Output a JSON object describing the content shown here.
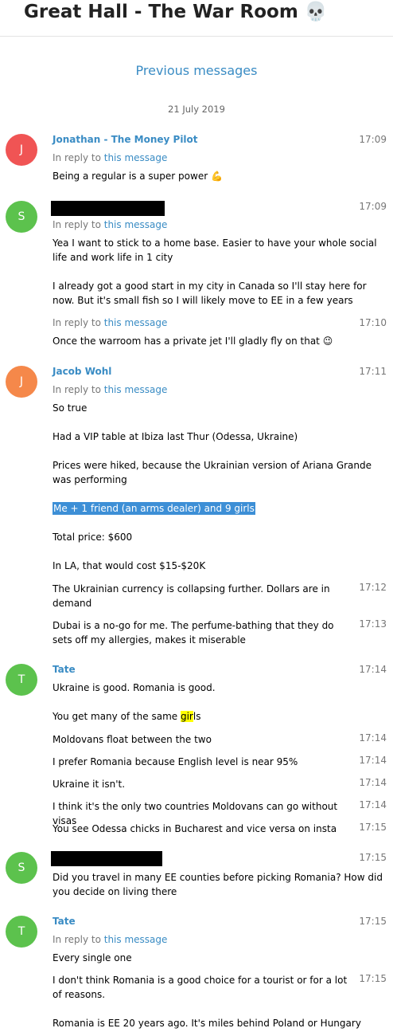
{
  "header": {
    "title": "Great Hall - The War Room",
    "title_icon": "💀"
  },
  "previous_messages": "Previous messages",
  "date_separator": "21 July 2019",
  "reply_prefix": "In reply to ",
  "reply_link": "this message",
  "colors": {
    "accent": "#3a8cc4",
    "avatar_red": "#f05454",
    "avatar_green": "#5cc24d",
    "avatar_orange": "#f5884a"
  },
  "messages": [
    {
      "avatar": "J",
      "sender": "Jonathan - The Money Pilot",
      "time": "17:09",
      "text": "Being a regular is a super power",
      "emoji": "💪"
    },
    {
      "avatar": "S",
      "time": "17:09",
      "text1": "Yea I want to stick to a home base. Easier to have your whole social life and work life in 1 city",
      "text2": "I already got a good start in my city in Canada so I'll stay here for now. But it's small fish so I will likely move to EE in a few years",
      "time2": "17:10",
      "text3": "Once the warroom has a private jet I'll gladly fly on that",
      "emoji3": "😉"
    },
    {
      "avatar": "J",
      "sender": "Jacob Wohl",
      "time": "17:11",
      "lines": [
        "So true",
        "Had a VIP table at Ibiza last Thur (Odessa, Ukraine)",
        "Prices were hiked, because the Ukrainian version of Ariana Grande was performing",
        "Me + 1 friend (an arms dealer) and 9 girls",
        "Total price: $600",
        "In LA, that would cost $15-$20K"
      ],
      "text_b": "The Ukrainian currency is collapsing further. Dollars are in demand",
      "time_b": "17:12",
      "text_c": "Dubai is a no-go for me. The perfume-bathing that they do sets off my allergies, makes it miserable",
      "time_c": "17:13"
    },
    {
      "avatar": "T",
      "sender": "Tate",
      "time": "17:14",
      "text1": "Ukraine is good. Romania is good.",
      "text2_pre": "You get many of the same ",
      "text2_hl": "gir",
      "text2_post": "ls",
      "items": [
        {
          "text": "Moldovans float between the two",
          "time": "17:14"
        },
        {
          "text": "I prefer Romania because English level is near 95%",
          "time": "17:14"
        },
        {
          "text": "Ukraine it isn't.",
          "time": "17:14"
        },
        {
          "text": "I think it's the only two countries Moldovans can go without visas",
          "time": "17:14"
        },
        {
          "text": "You see Odessa chicks in Bucharest and vice versa on insta",
          "time": "17:15"
        }
      ]
    },
    {
      "avatar": "S",
      "time": "17:15",
      "text": "Did you travel in many EE counties before picking Romania? How did you decide on living there"
    },
    {
      "avatar": "T",
      "sender": "Tate",
      "time": "17:15",
      "text1": "Every single one",
      "text2": "I don't think Romania is a good choice for a tourist or for a lot of reasons.",
      "time2": "17:15",
      "text3": "Romania is EE 20 years ago. It's miles behind Poland or Hungary"
    }
  ]
}
